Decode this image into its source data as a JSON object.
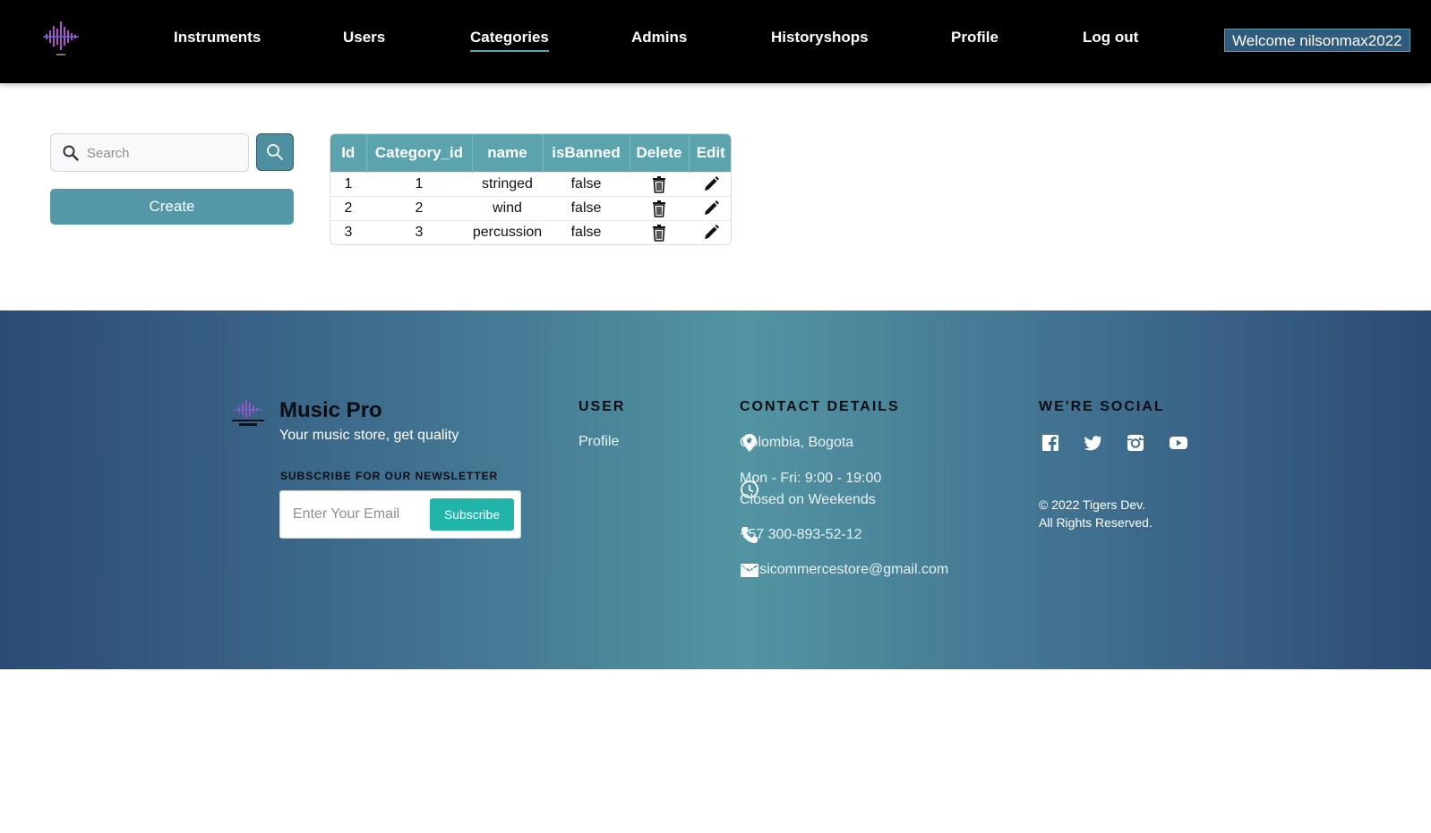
{
  "nav": {
    "links": [
      "Instruments",
      "Users",
      "Categories",
      "Admins",
      "Historyshops",
      "Profile",
      "Log out"
    ],
    "active": "Categories",
    "welcome": "Welcome nilsonmax2022"
  },
  "search": {
    "placeholder": "Search",
    "value": ""
  },
  "create_label": "Create",
  "table": {
    "headers": [
      "Id",
      "Category_id",
      "name",
      "isBanned",
      "Delete",
      "Edit"
    ],
    "rows": [
      {
        "id": "1",
        "category_id": "1",
        "name": "stringed",
        "isBanned": "false"
      },
      {
        "id": "2",
        "category_id": "2",
        "name": "wind",
        "isBanned": "false"
      },
      {
        "id": "3",
        "category_id": "3",
        "name": "percussion",
        "isBanned": "false"
      }
    ]
  },
  "footer": {
    "brand": "Music Pro",
    "tagline": "Your music store, get quality",
    "newsletter_label": "SUBSCRIBE FOR OUR NEWSLETTER",
    "email_placeholder": "Enter Your Email",
    "subscribe_label": "Subscribe",
    "user_heading": "USER",
    "user_link": "Profile",
    "contact_heading": "CONTACT DETAILS",
    "location": "Colombia, Bogota",
    "hours_line1": "Mon - Fri: 9:00 - 19:00",
    "hours_line2": "Closed on Weekends",
    "phone": "+57 300-893-52-12",
    "email": "musicommercestore@gmail.com",
    "social_heading": "WE'RE SOCIAL",
    "social_icons": [
      "facebook-icon",
      "twitter-icon",
      "instagram-icon",
      "youtube-icon"
    ],
    "copyright_line1": "© 2022 Tigers Dev.",
    "copyright_line2": "All Rights Reserved."
  },
  "colors": {
    "nav_bg": "#000000",
    "accent": "#5ba4ad",
    "button": "#5497a6",
    "subscribe": "#21b4a8",
    "welcome_bg": "#2f5b7c"
  }
}
